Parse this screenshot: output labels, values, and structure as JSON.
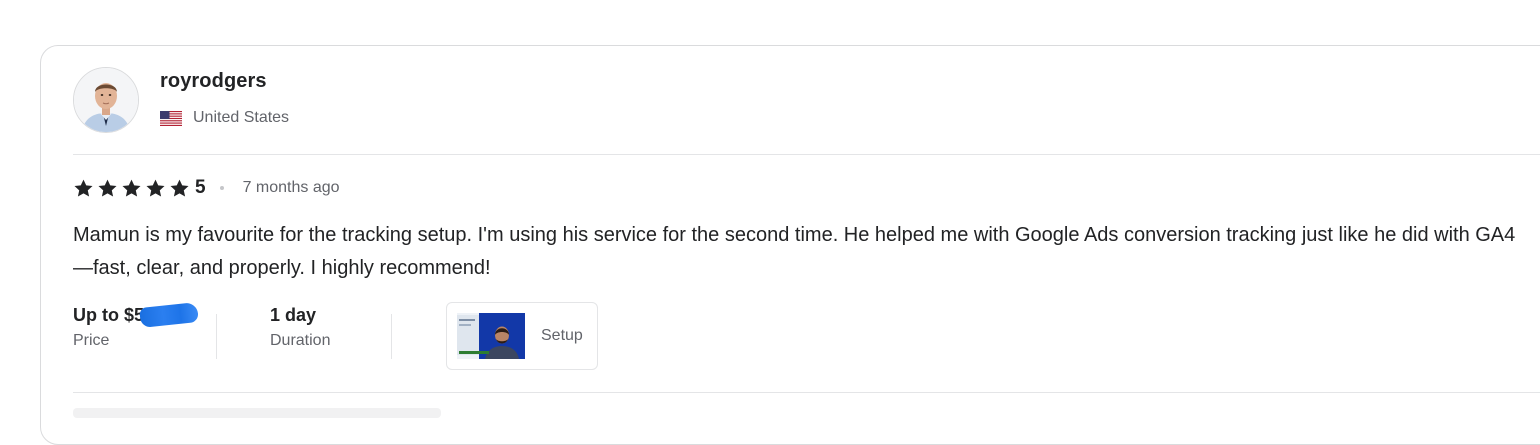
{
  "review": {
    "username": "royrodgers",
    "country": "United States",
    "rating": {
      "value": "5",
      "stars": 5,
      "max": 5
    },
    "time_ago": "7 months ago",
    "text": "Mamun is my favourite for the tracking setup. I'm using his service for the second time. He helped me with Google Ads conversion tracking just like he did with GA4—fast, clear, and properly. I highly recommend!",
    "price": {
      "value": "Up to $5",
      "label": "Price"
    },
    "duration": {
      "value": "1 day",
      "label": "Duration"
    },
    "gig": {
      "label": "Setup"
    }
  },
  "colors": {
    "text_primary": "#222325",
    "text_secondary": "#62646a",
    "border": "#dadbdd",
    "star": "#222325",
    "redaction": "#1a6fe0"
  },
  "icons": [
    "avatar-photo",
    "us-flag-icon",
    "star-icon",
    "gig-thumbnail"
  ]
}
